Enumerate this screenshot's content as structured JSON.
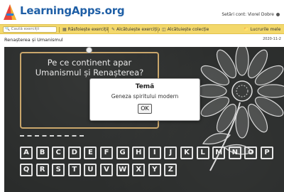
{
  "header": {
    "logo_text": "LearningApps.org",
    "account_label": "Setări cont: Viorel Dobre"
  },
  "navbar": {
    "search_placeholder": "Caută exerciții",
    "items": [
      {
        "label": "Răsfoiește exerciții",
        "icon": "grid-icon"
      },
      {
        "label": "Alcătuiește exercițiu",
        "icon": "pencil-icon"
      },
      {
        "label": "Alcătuiește colecție",
        "icon": "collection-icon"
      },
      {
        "label": "Lucrurile mele",
        "icon": "folder-icon"
      }
    ]
  },
  "app": {
    "title": "Renașterea și Umanismul",
    "date": "2020-11-2"
  },
  "board": {
    "question": "Pe ce continent apar Umanismul și Renașterea?",
    "keyboard": {
      "row1": [
        "A",
        "B",
        "C",
        "D",
        "E",
        "F",
        "G",
        "H",
        "I",
        "J",
        "K",
        "L",
        "M",
        "N",
        "O",
        "P"
      ],
      "row2": [
        "Q",
        "R",
        "S",
        "T",
        "U",
        "V",
        "W",
        "X",
        "Y",
        "Z"
      ]
    }
  },
  "modal": {
    "title": "Temă",
    "text": "Geneza spiritului modern",
    "ok_label": "OK"
  },
  "colors": {
    "navbar": "#f3d86b",
    "board": "#2a2c2b",
    "logo": "#1f5fa6",
    "chalk": "#e6e6e6",
    "frame": "#c9a66b"
  }
}
